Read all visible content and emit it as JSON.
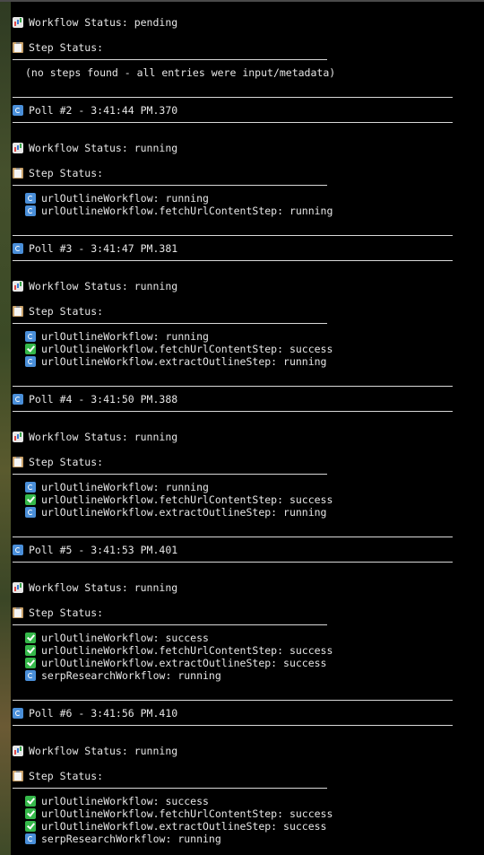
{
  "colors": {
    "background": "#000000",
    "text": "#e6e6e6",
    "rule": "#d8d8d8",
    "running_icon": "#4a8fd9",
    "success_icon": "#35b84a"
  },
  "section_initial": {
    "workflow_status": "Workflow Status: pending",
    "step_status_label": "Step Status:",
    "no_steps_message": "(no steps found - all entries were input/metadata)"
  },
  "polls": [
    {
      "header": "Poll #2 - 3:41:44 PM.370",
      "workflow_status": "Workflow Status: running",
      "step_status_label": "Step Status:",
      "steps": [
        {
          "icon": "refresh-icon",
          "text": "urlOutlineWorkflow: running"
        },
        {
          "icon": "refresh-icon",
          "text": "urlOutlineWorkflow.fetchUrlContentStep: running"
        }
      ]
    },
    {
      "header": "Poll #3 - 3:41:47 PM.381",
      "workflow_status": "Workflow Status: running",
      "step_status_label": "Step Status:",
      "steps": [
        {
          "icon": "refresh-icon",
          "text": "urlOutlineWorkflow: running"
        },
        {
          "icon": "check-icon",
          "text": "urlOutlineWorkflow.fetchUrlContentStep: success"
        },
        {
          "icon": "refresh-icon",
          "text": "urlOutlineWorkflow.extractOutlineStep: running"
        }
      ]
    },
    {
      "header": "Poll #4 - 3:41:50 PM.388",
      "workflow_status": "Workflow Status: running",
      "step_status_label": "Step Status:",
      "steps": [
        {
          "icon": "refresh-icon",
          "text": "urlOutlineWorkflow: running"
        },
        {
          "icon": "check-icon",
          "text": "urlOutlineWorkflow.fetchUrlContentStep: success"
        },
        {
          "icon": "refresh-icon",
          "text": "urlOutlineWorkflow.extractOutlineStep: running"
        }
      ]
    },
    {
      "header": "Poll #5 - 3:41:53 PM.401",
      "workflow_status": "Workflow Status: running",
      "step_status_label": "Step Status:",
      "steps": [
        {
          "icon": "check-icon",
          "text": "urlOutlineWorkflow: success"
        },
        {
          "icon": "check-icon",
          "text": "urlOutlineWorkflow.fetchUrlContentStep: success"
        },
        {
          "icon": "check-icon",
          "text": "urlOutlineWorkflow.extractOutlineStep: success"
        },
        {
          "icon": "refresh-icon",
          "text": "serpResearchWorkflow: running"
        }
      ]
    },
    {
      "header": "Poll #6 - 3:41:56 PM.410",
      "workflow_status": "Workflow Status: running",
      "step_status_label": "Step Status:",
      "steps": [
        {
          "icon": "check-icon",
          "text": "urlOutlineWorkflow: success"
        },
        {
          "icon": "check-icon",
          "text": "urlOutlineWorkflow.fetchUrlContentStep: success"
        },
        {
          "icon": "check-icon",
          "text": "urlOutlineWorkflow.extractOutlineStep: success"
        },
        {
          "icon": "refresh-icon",
          "text": "serpResearchWorkflow: running"
        }
      ]
    }
  ]
}
